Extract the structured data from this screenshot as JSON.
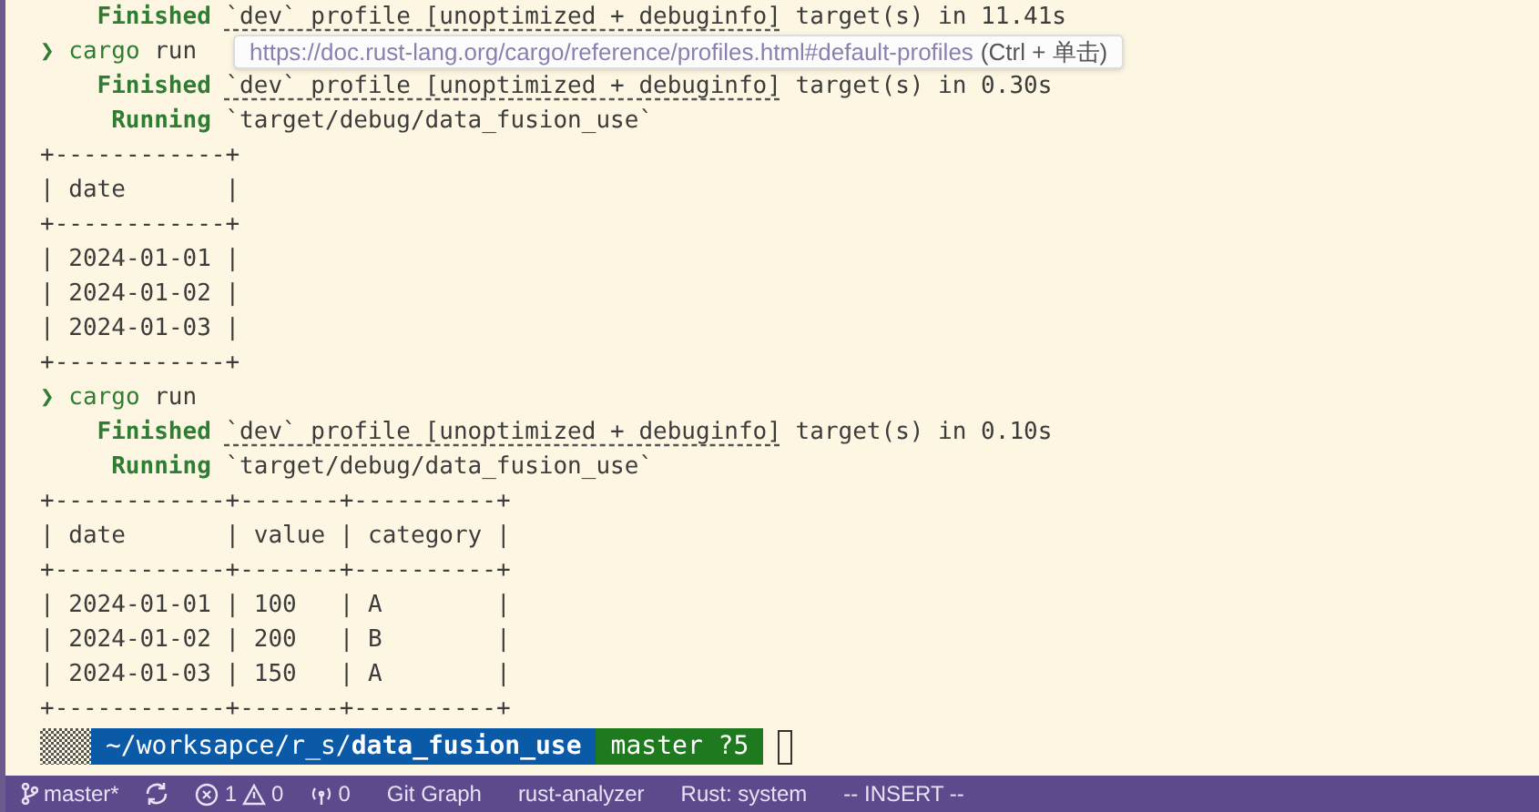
{
  "terminal": {
    "lines": [
      {
        "kind": "status",
        "label": "Finished",
        "link": "`dev` profile [unoptimized + debuginfo]",
        "text": " target(s) in 11.41s"
      },
      {
        "kind": "prompt",
        "symbol": "❯",
        "command": "cargo",
        "args": "run"
      },
      {
        "kind": "status",
        "label": "Finished",
        "link": "`dev` profile [unoptimized + debuginfo]",
        "text": " target(s) in 0.30s"
      },
      {
        "kind": "status",
        "label": "Running",
        "text": "`target/debug/data_fusion_use`"
      },
      {
        "kind": "text",
        "text": "+------------+"
      },
      {
        "kind": "text",
        "text": "| date       |"
      },
      {
        "kind": "text",
        "text": "+------------+"
      },
      {
        "kind": "text",
        "text": "| 2024-01-01 |"
      },
      {
        "kind": "text",
        "text": "| 2024-01-02 |"
      },
      {
        "kind": "text",
        "text": "| 2024-01-03 |"
      },
      {
        "kind": "text",
        "text": "+------------+"
      },
      {
        "kind": "prompt",
        "symbol": "❯",
        "command": "cargo",
        "args": "run"
      },
      {
        "kind": "status",
        "label": "Finished",
        "link": "`dev` profile [unoptimized + debuginfo]",
        "text": " target(s) in 0.10s"
      },
      {
        "kind": "status",
        "label": "Running",
        "text": "`target/debug/data_fusion_use`"
      },
      {
        "kind": "text",
        "text": "+------------+-------+----------+"
      },
      {
        "kind": "text",
        "text": "| date       | value | category |"
      },
      {
        "kind": "text",
        "text": "+------------+-------+----------+"
      },
      {
        "kind": "text",
        "text": "| 2024-01-01 | 100   | A        |"
      },
      {
        "kind": "text",
        "text": "| 2024-01-02 | 200   | B        |"
      },
      {
        "kind": "text",
        "text": "| 2024-01-03 | 150   | A        |"
      },
      {
        "kind": "text",
        "text": "+------------+-------+----------+"
      }
    ],
    "prompt": {
      "path": "~/worksapce/r_s/",
      "dir": "data_fusion_use",
      "git": "master ?5"
    }
  },
  "tooltip": {
    "url": "https://doc.rust-lang.org/cargo/reference/profiles.html#default-profiles",
    "hint": "(Ctrl + 单击)"
  },
  "status_bar": {
    "branch": "master*",
    "errors": "1",
    "warnings": "0",
    "ports": "0",
    "items": [
      "Git Graph",
      "rust-analyzer",
      "Rust: system",
      "-- INSERT --"
    ]
  }
}
